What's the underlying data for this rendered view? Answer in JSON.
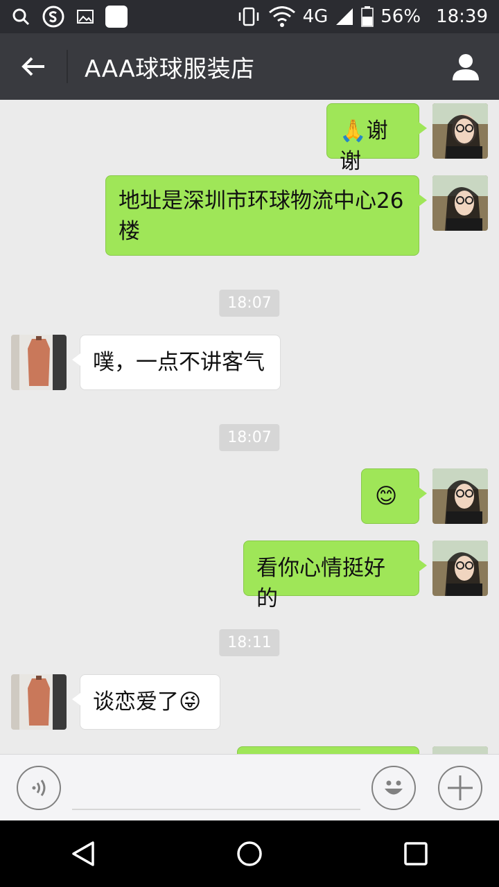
{
  "status_bar": {
    "battery": "56%",
    "time": "18:39",
    "network": "4G",
    "icons": [
      "search-icon",
      "sogou-icon",
      "image-icon",
      "app-square-icon",
      "vibrate-icon",
      "wifi-icon",
      "signal-icon",
      "battery-icon"
    ]
  },
  "header": {
    "title": "AAA球球服装店",
    "back_icon": "arrow-left-icon",
    "profile_icon": "person-icon"
  },
  "messages": [
    {
      "type": "out",
      "text": "谢谢",
      "emoji": "🙏"
    },
    {
      "type": "out",
      "text": "地址是深圳市环球物流中心26楼"
    },
    {
      "type": "time",
      "text": "18:07"
    },
    {
      "type": "in",
      "text": "噗，一点不讲客气"
    },
    {
      "type": "time",
      "text": "18:07"
    },
    {
      "type": "out",
      "text": "",
      "emoji": "😊"
    },
    {
      "type": "out",
      "text": "看你心情挺好的"
    },
    {
      "type": "time",
      "text": "18:11"
    },
    {
      "type": "in",
      "text": "谈恋爱了",
      "emoji": "😜"
    }
  ],
  "input_bar": {
    "voice_icon": "voice-icon",
    "emoji_icon": "smiley-icon",
    "plus_icon": "plus-icon"
  },
  "nav_bar": {
    "back_icon": "triangle-back-icon",
    "home_icon": "circle-home-icon",
    "recents_icon": "square-recents-icon"
  },
  "colors": {
    "outgoing_bubble": "#9fe658",
    "incoming_bubble": "#ffffff",
    "chat_bg": "#ebebeb",
    "title_bar": "#393a3f"
  }
}
